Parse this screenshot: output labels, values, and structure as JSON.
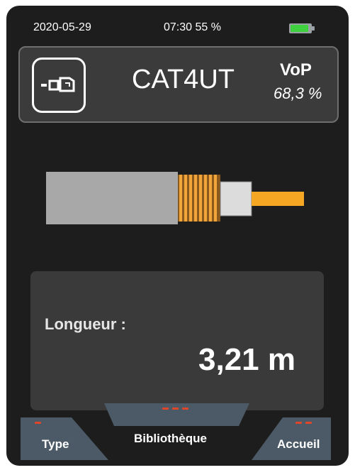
{
  "status": {
    "date": "2020-05-29",
    "time_battery": "07:30 55 %",
    "battery_icon": "battery-icon",
    "battery_level": 0.55,
    "battery_color": "#3fd13f"
  },
  "cable": {
    "name": "CAT4UT",
    "vop_label": "VoP",
    "vop_value": "68,3 %",
    "connector_icon": "connector-icon"
  },
  "result": {
    "length_label": "Longueur :",
    "length_value": "3,21 m"
  },
  "softkeys": {
    "type": "Type",
    "library": "Bibliothèque",
    "home": "Accueil",
    "indicator_color": "#e0462a"
  }
}
